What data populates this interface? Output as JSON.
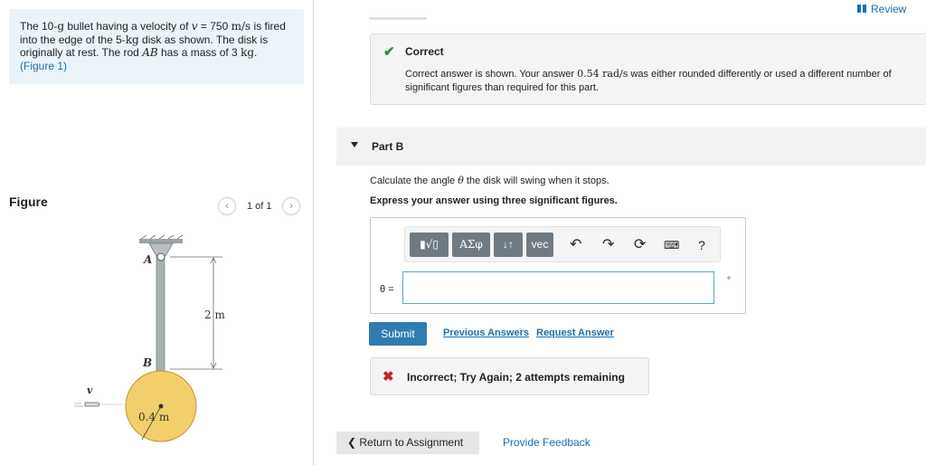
{
  "problem": {
    "text_1": "The 10-",
    "unit_g": "g",
    "text_2": " bullet having a velocity of ",
    "var_v": "v",
    "text_3": " = 750 ",
    "unit_ms": "m/s",
    "text_4": " is fired into the edge of the 5-",
    "unit_kg": "kg",
    "text_5": " disk as shown. The disk is originally at rest. The rod ",
    "rod": "AB",
    "text_6": " has a mass of 3 ",
    "unit_kg2": "kg",
    "text_7": ".",
    "figure_link": "(Figure 1)"
  },
  "figure": {
    "title": "Figure",
    "counter": "1 of 1",
    "prev_icon": "chevron-left-icon",
    "next_icon": "chevron-right-icon",
    "label_A": "A",
    "label_B": "B",
    "label_v": "v",
    "label_length": "2 m",
    "label_radius": "0.4 m"
  },
  "header": {
    "review": "Review"
  },
  "feedback_correct": {
    "title": "Correct",
    "message_1": "Correct answer is shown. Your answer ",
    "message_value": "0.54 rad/s",
    "message_2": " was either rounded differently or used a different number of significant figures than required for this part."
  },
  "part": {
    "label": "Part B",
    "question_1": "Calculate the angle ",
    "question_var": "θ",
    "question_2": " the disk will swing when it stops.",
    "instruction": "Express your answer using three significant figures."
  },
  "toolbar": {
    "greek": "ΑΣφ",
    "arrows": "↓↑",
    "vec": "vec",
    "help": "?",
    "icons": [
      "templates-icon",
      "undo-icon",
      "redo-icon",
      "reset-icon",
      "keyboard-icon",
      "help-icon"
    ]
  },
  "answer": {
    "variable": "θ =",
    "value": "",
    "unit": "°"
  },
  "actions": {
    "submit": "Submit",
    "previous_answers": "Previous Answers",
    "request_answer": "Request Answer"
  },
  "feedback_incorrect": {
    "message": "Incorrect; Try Again; 2 attempts remaining"
  },
  "footer": {
    "return": "Return to Assignment",
    "provide_feedback": "Provide Feedback"
  },
  "colors": {
    "link": "#1b6fb0",
    "submit_bg": "#2f7db0",
    "correct": "#2e8b3a",
    "incorrect": "#c8232a",
    "disk": "#f2cf6a",
    "problem_bg": "#eaf4f8"
  }
}
